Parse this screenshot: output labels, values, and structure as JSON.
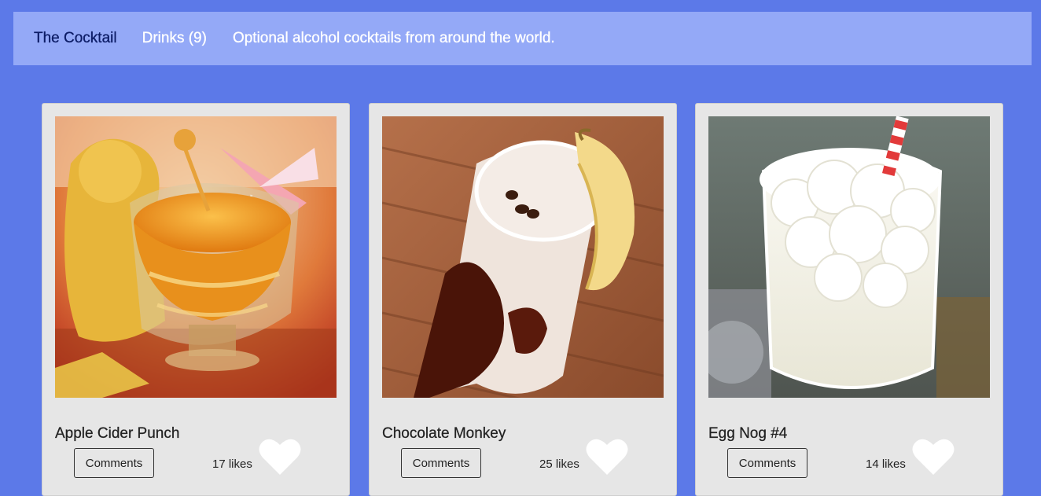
{
  "nav": {
    "brand": "The Cocktail",
    "drinks_link": "Drinks (9)",
    "tagline": "Optional alcohol cocktails from around the world."
  },
  "colors": {
    "page_background": "#5c79e8",
    "navbar_background": "#94a9f7",
    "brand_text": "#0c1c66",
    "card_background": "#e6e6e6",
    "heart": "#ffffff"
  },
  "cards": [
    {
      "title": "Apple Cider Punch",
      "comments_label": "Comments",
      "likes": "17 likes",
      "heart_icon": "heart-icon",
      "photo": "cocktail-photo-apple-cider-punch"
    },
    {
      "title": "Chocolate Monkey",
      "comments_label": "Comments",
      "likes": "25 likes",
      "heart_icon": "heart-icon",
      "photo": "cocktail-photo-chocolate-monkey"
    },
    {
      "title": "Egg Nog #4",
      "comments_label": "Comments",
      "likes": "14 likes",
      "heart_icon": "heart-icon",
      "photo": "cocktail-photo-egg-nog"
    }
  ]
}
